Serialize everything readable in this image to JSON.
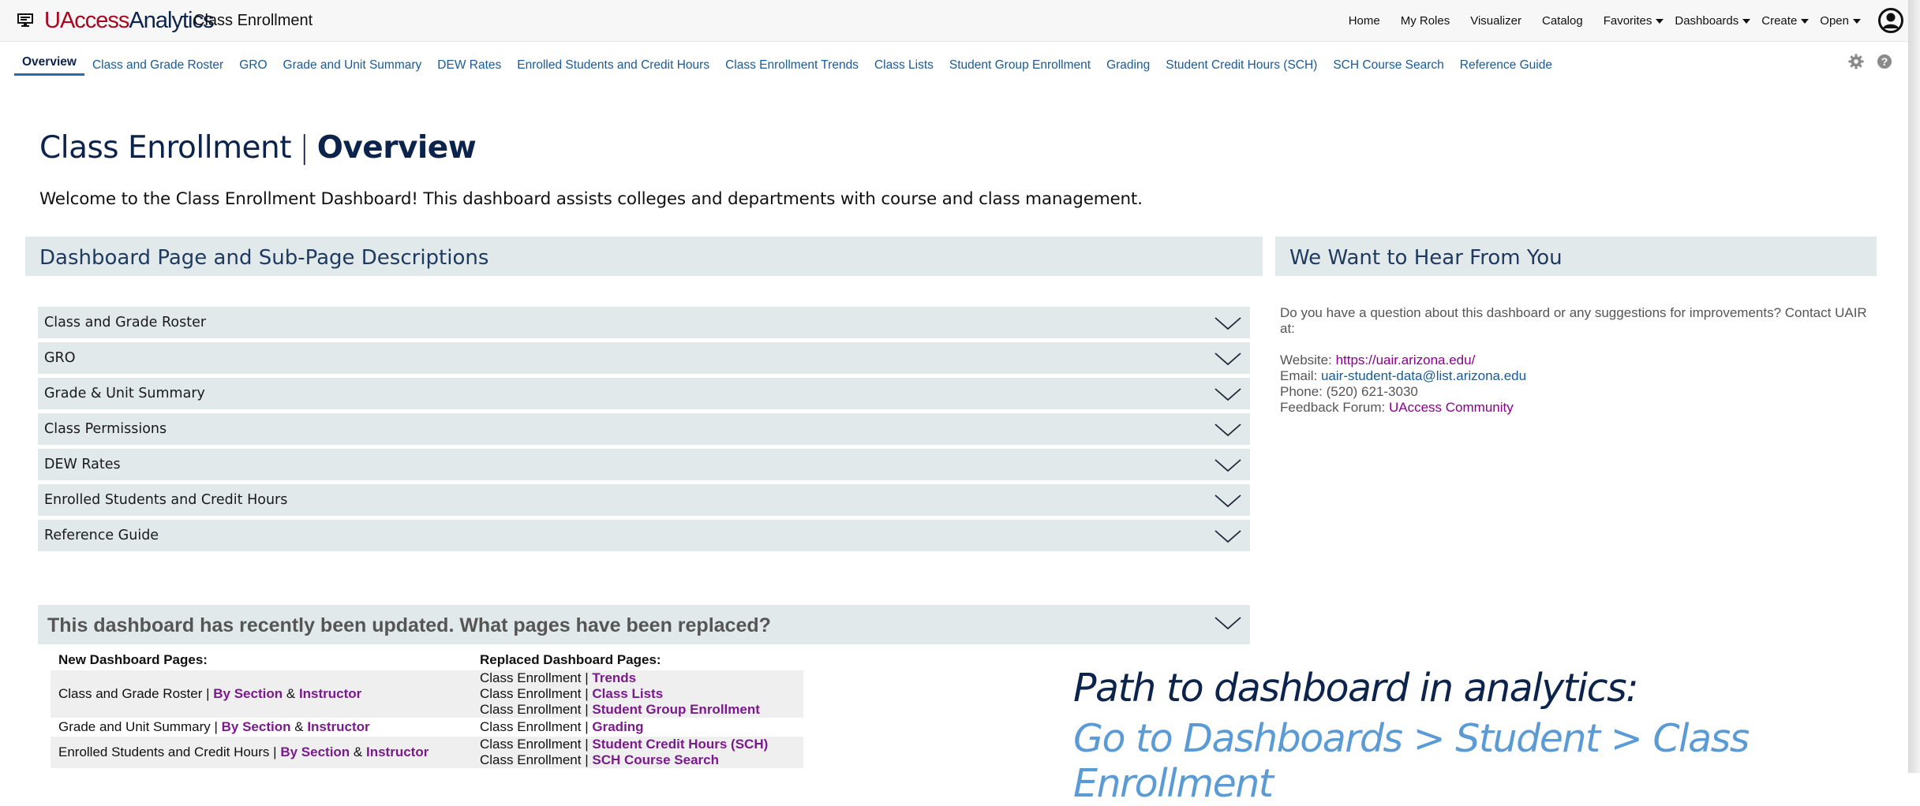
{
  "header": {
    "brand_part1": "UAccess",
    "brand_part2": "Analytics",
    "page_name": "Class Enrollment",
    "nav": [
      "Home",
      "My Roles",
      "Visualizer",
      "Catalog"
    ],
    "nav_dropdowns": [
      "Favorites",
      "Dashboards",
      "Create",
      "Open"
    ]
  },
  "tabs": [
    "Overview",
    "Class and Grade Roster",
    "GRO",
    "Grade and Unit Summary",
    "DEW Rates",
    "Enrolled Students and Credit Hours",
    "Class Enrollment Trends",
    "Class Lists",
    "Student Group Enrollment",
    "Grading",
    "Student Credit Hours (SCH)",
    "SCH Course Search",
    "Reference Guide"
  ],
  "main": {
    "title_prefix": "Class Enrollment",
    "title_separator": "|",
    "title_bold": "Overview",
    "welcome": "Welcome to the Class Enrollment Dashboard! This dashboard assists colleges and departments with course and class management."
  },
  "descriptions": {
    "heading": "Dashboard Page and Sub-Page Descriptions",
    "items": [
      "Class and Grade Roster",
      "GRO",
      "Grade & Unit Summary",
      "Class Permissions",
      "DEW Rates",
      "Enrolled Students and Credit Hours",
      "Reference Guide"
    ]
  },
  "contact": {
    "heading": "We Want to Hear From You",
    "intro": "Do you have a question about this dashboard or any suggestions for improvements? Contact UAIR at:",
    "website_label": "Website:",
    "website": "https://uair.arizona.edu/",
    "email_label": "Email:",
    "email": "uair-student-data@list.arizona.edu",
    "phone_label": "Phone:",
    "phone": "(520) 621-3030",
    "forum_label": "Feedback Forum:",
    "forum": "UAccess Community"
  },
  "updates": {
    "heading": "This dashboard has recently been updated. What pages have been replaced?",
    "col_new": "New Dashboard Pages:",
    "col_replaced": "Replaced Dashboard Pages:",
    "joiner": "|",
    "amp": "&",
    "replaced_prefix": "Class Enrollment",
    "rows": [
      {
        "new_page": "Class and Grade Roster",
        "by_section": "By Section",
        "by_instructor": "Instructor",
        "replaced": [
          "Trends",
          "Class Lists",
          "Student Group Enrollment"
        ]
      },
      {
        "new_page": "Grade and Unit Summary",
        "by_section": "By Section",
        "by_instructor": "Instructor",
        "replaced": [
          "Grading"
        ]
      },
      {
        "new_page": "Enrolled Students and Credit Hours",
        "by_section": "By Section",
        "by_instructor": "Instructor",
        "replaced": [
          "Student Credit Hours (SCH)",
          "SCH Course Search"
        ]
      }
    ]
  },
  "path": {
    "line1": "Path to dashboard in analytics:",
    "line2": "Go to Dashboards > Student > Class Enrollment"
  },
  "colors": {
    "brand_red": "#ab0520",
    "brand_navy": "#0c234b",
    "link_blue": "#1a5a96",
    "link_purple": "#7b1a8c",
    "panel_gray": "#e2e9eb",
    "path_light_blue": "#5b9bd5"
  },
  "icons": [
    "app-monitor-icon",
    "caret-down-icon",
    "user-avatar-icon",
    "gear-icon",
    "help-icon",
    "chevron-down-icon"
  ]
}
